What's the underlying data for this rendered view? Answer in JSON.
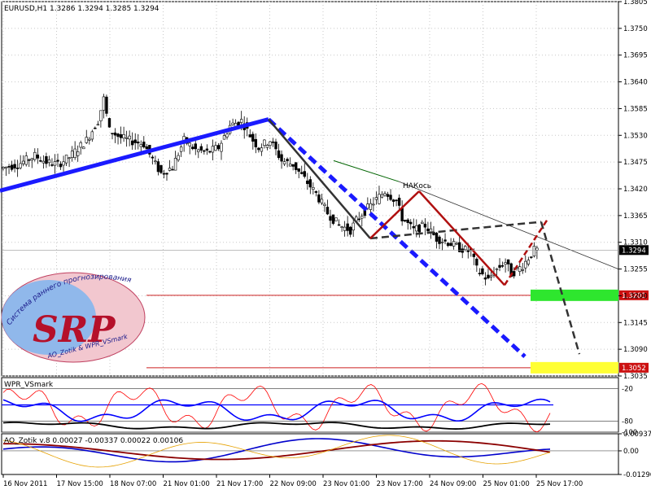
{
  "window": {
    "title": "EURUSD,H1  1.3286 1.3294 1.3285 1.3294"
  },
  "chart_data": [
    {
      "type": "candlestick",
      "title": "EURUSD,H1  1.3286 1.3294 1.3285 1.3294",
      "symbol": "EURUSD",
      "timeframe": "H1",
      "ohlc_last": [
        1.3286,
        1.3294,
        1.3285,
        1.3294
      ],
      "ylim": [
        1.3035,
        1.3805
      ],
      "y_ticks": [
        "1.3805",
        "1.3750",
        "1.3695",
        "1.3640",
        "1.3585",
        "1.3530",
        "1.3475",
        "1.3420",
        "1.3365",
        "1.3310",
        "1.3255",
        "1.3200",
        "1.3145",
        "1.3090",
        "1.3035"
      ],
      "x_ticks": [
        "16 Nov 2011",
        "17 Nov 15:00",
        "18 Nov 07:00",
        "21 Nov 01:00",
        "21 Nov 17:00",
        "22 Nov 09:00",
        "23 Nov 01:00",
        "23 Nov 17:00",
        "24 Nov 09:00",
        "25 Nov 01:00",
        "25 Nov 17:00"
      ],
      "price_path": [
        [
          0,
          1.3462
        ],
        [
          3,
          1.347
        ],
        [
          6,
          1.3488
        ],
        [
          8,
          1.3475
        ],
        [
          10,
          1.347
        ],
        [
          12,
          1.3485
        ],
        [
          15,
          1.352
        ],
        [
          17,
          1.356
        ],
        [
          18,
          1.3605
        ],
        [
          19,
          1.354
        ],
        [
          21,
          1.3525
        ],
        [
          23,
          1.3518
        ],
        [
          25,
          1.3512
        ],
        [
          27,
          1.347
        ],
        [
          28,
          1.3452
        ],
        [
          30,
          1.3465
        ],
        [
          32,
          1.352
        ],
        [
          34,
          1.35
        ],
        [
          36,
          1.3495
        ],
        [
          38,
          1.3505
        ],
        [
          40,
          1.355
        ],
        [
          42,
          1.356
        ],
        [
          44,
          1.352
        ],
        [
          45,
          1.3505
        ],
        [
          47,
          1.352
        ],
        [
          49,
          1.3478
        ],
        [
          51,
          1.347
        ],
        [
          53,
          1.344
        ],
        [
          55,
          1.341
        ],
        [
          57,
          1.337
        ],
        [
          59,
          1.3345
        ],
        [
          61,
          1.3335
        ],
        [
          62,
          1.3355
        ],
        [
          63,
          1.3368
        ],
        [
          65,
          1.3392
        ],
        [
          67,
          1.3415
        ],
        [
          69,
          1.3395
        ],
        [
          70,
          1.336
        ],
        [
          72,
          1.3335
        ],
        [
          74,
          1.3345
        ],
        [
          76,
          1.3318
        ],
        [
          78,
          1.331
        ],
        [
          80,
          1.3298
        ],
        [
          82,
          1.329
        ],
        [
          83,
          1.3255
        ],
        [
          85,
          1.3232
        ],
        [
          86,
          1.325
        ],
        [
          88,
          1.327
        ],
        [
          89,
          1.3245
        ],
        [
          91,
          1.3262
        ],
        [
          93,
          1.3294
        ]
      ],
      "current_price_label": "1.3294",
      "horizontal_levels": [
        {
          "label": "1.3201",
          "price": 1.3201,
          "zone_color": "#2ee62e"
        },
        {
          "label": "1.3052",
          "price": 1.3052,
          "zone_color": "#ffff33"
        }
      ],
      "annotations": [
        {
          "text": "НАКось"
        }
      ],
      "watermark": {
        "text": "SRP",
        "arc_text": "Система раннего прогнозирования",
        "sub_text": "AO_Zotik & WPR_VSmark"
      },
      "colors": {
        "blue_trend": "#1a1aff",
        "red_pattern": "#b01010",
        "dark_pattern": "#333333",
        "green_line": "#006400"
      }
    },
    {
      "type": "line",
      "title": "WPR_VSmark",
      "ylim": [
        -100,
        0
      ],
      "y_ticks": [
        "-20",
        "-80",
        "-100"
      ],
      "series_colors": [
        "#ff0000",
        "#0000ff",
        "#000000"
      ]
    },
    {
      "type": "line",
      "title": "AO_Zotik v.8 0.00027 -0.00337 0.00022 0.00106",
      "y_ticks": [
        "0.00937",
        "0.00",
        "-0.01296"
      ],
      "series_colors": [
        "#0000cc",
        "#8b0000",
        "#e6a100"
      ]
    }
  ]
}
